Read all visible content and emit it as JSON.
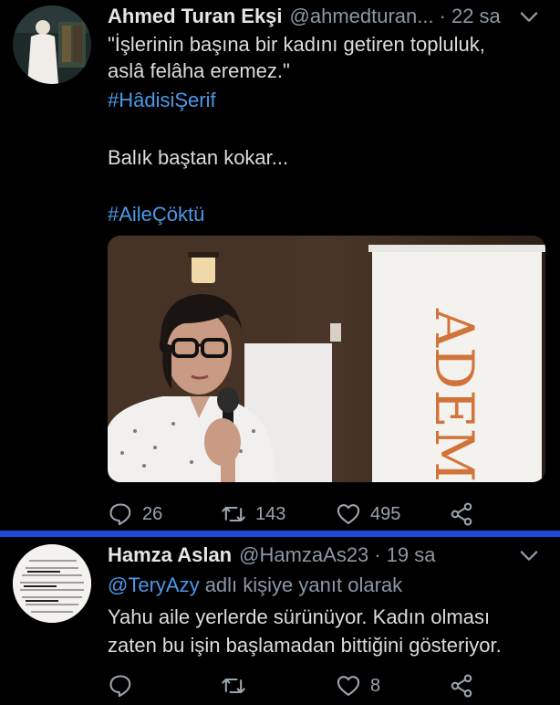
{
  "tweets": [
    {
      "author": {
        "name": "Ahmed Turan Ekşi",
        "handle": "@ahmedturan...",
        "time": "22 sa"
      },
      "text_lines": [
        "\"İşlerinin başına bir kadını getiren topluluk,",
        "aslâ felâha eremez.\""
      ],
      "hashtag1": "#HâdisiŞerif",
      "body2": "Balık baştan kokar...",
      "hashtag2": "#AileÇöktü",
      "media": {
        "banner_text": "ADEM"
      },
      "stats": {
        "replies": "26",
        "retweets": "143",
        "likes": "495"
      }
    },
    {
      "author": {
        "name": "Hamza Aslan",
        "handle": "@HamzaAs23",
        "time": "19 sa"
      },
      "reply_to": {
        "mention": "@TeryAzy",
        "suffix": " adlı kişiye yanıt olarak"
      },
      "text_lines": [
        "Yahu aile yerlerde sürünüyor. Kadın olması",
        "zaten bu işin başlamadan bittiğini gösteriyor."
      ],
      "stats": {
        "replies": "",
        "retweets": "",
        "likes": "8"
      }
    }
  ],
  "colors": {
    "link": "#4a99e9",
    "divider": "#1d4bd8",
    "muted": "#8b98a5"
  }
}
